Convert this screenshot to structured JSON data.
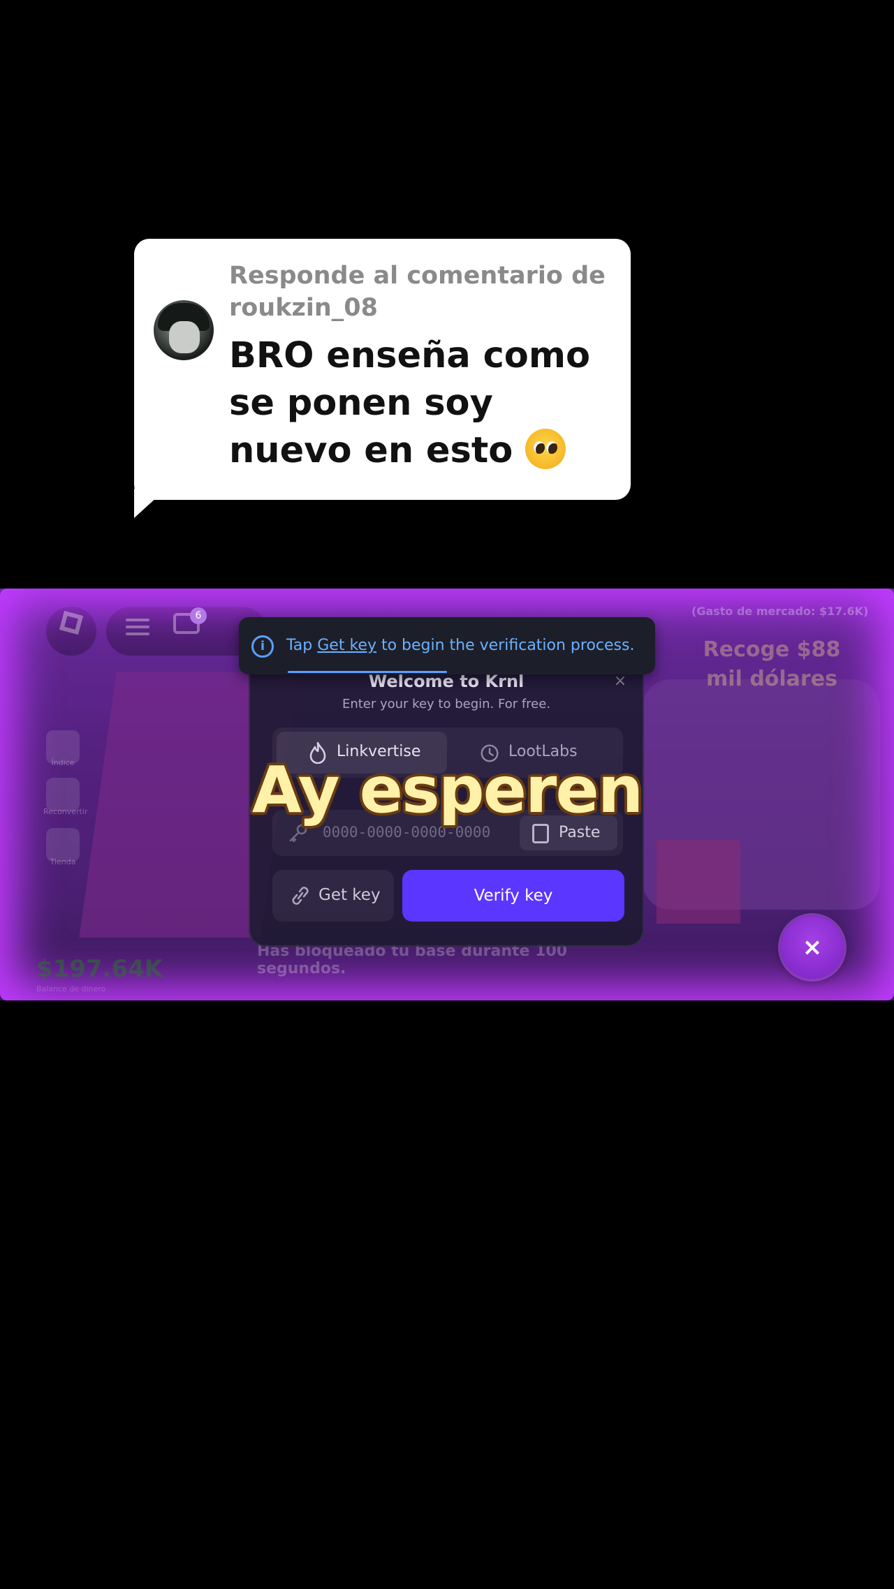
{
  "comment": {
    "reply_to": "Responde al comentario de roukzin_08",
    "text": "BRO enseña como se ponen soy nuevo en esto"
  },
  "game": {
    "chat_badge": "6",
    "top_right_small": "(Gasto de mercado: $17.6K)",
    "recoge": "Recoge $88 mil dólares",
    "sidebar": [
      {
        "label": "Índice"
      },
      {
        "label": "Reconvertir"
      },
      {
        "label": "Tienda"
      }
    ],
    "money": "$197.64K",
    "money_sub": "Balance de dinero",
    "blocked_message": "Has bloqueado tu base durante 100 segundos."
  },
  "tooltip": {
    "prefix": "Tap ",
    "link": "Get key",
    "suffix": " to begin the verification process.",
    "progress": 0.5
  },
  "dialog": {
    "title": "Welcome to Krnl",
    "subtitle": "Enter your key to begin. For free.",
    "close": "×",
    "tabs": [
      {
        "label": "Linkvertise",
        "icon": "flame-icon",
        "active": true
      },
      {
        "label": "LootLabs",
        "icon": "timer-icon",
        "active": false
      }
    ],
    "key_placeholder": "0000-0000-0000-0000",
    "paste_label": "Paste",
    "get_key_label": "Get key",
    "verify_label": "Verify key"
  },
  "caption": "Ay esperen",
  "fab_close": "×",
  "colors": {
    "accent": "#5a36ff",
    "glow": "#c13bff",
    "tooltip_link": "#6cb0ff",
    "caption": "#fff2a8"
  }
}
